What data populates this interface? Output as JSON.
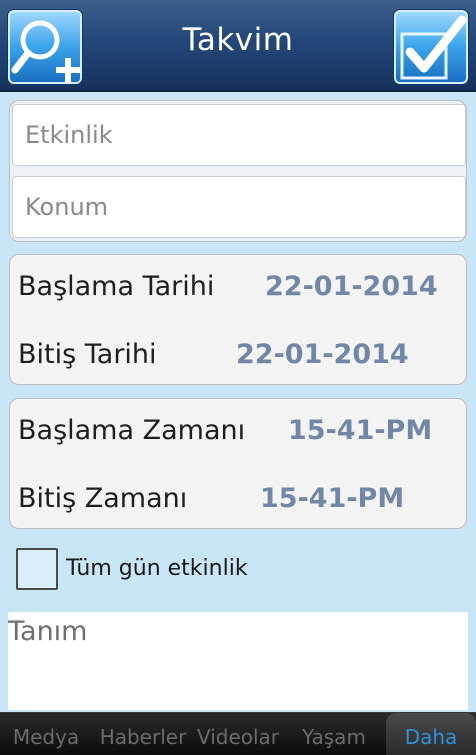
{
  "header": {
    "title": "Takvim",
    "left_icon": "search-add-icon",
    "right_icon": "checkmark-icon"
  },
  "form": {
    "event_placeholder": "Etkinlik",
    "location_placeholder": "Konum",
    "start_date_label": "Başlama Tarihi",
    "start_date_value": "22-01-2014",
    "end_date_label": "Bitiş Tarihi",
    "end_date_value": "22-01-2014",
    "start_time_label": "Başlama Zamanı",
    "start_time_value": "15-41-PM",
    "end_time_label": "Bitiş Zamanı",
    "end_time_value": "15-41-PM",
    "all_day_label": "Tüm gün etkinlik",
    "all_day_checked": false,
    "description_placeholder": "Tanım"
  },
  "tabs": [
    {
      "label": "Medya",
      "active": false
    },
    {
      "label": "Haberler",
      "active": false
    },
    {
      "label": "Videolar",
      "active": false
    },
    {
      "label": "Yaşam",
      "active": false
    },
    {
      "label": "Daha",
      "active": true
    }
  ],
  "colors": {
    "header": "#24477a",
    "background": "#c9e6f7",
    "value_text": "#7287a8",
    "active_tab": "#2f8fd6"
  }
}
